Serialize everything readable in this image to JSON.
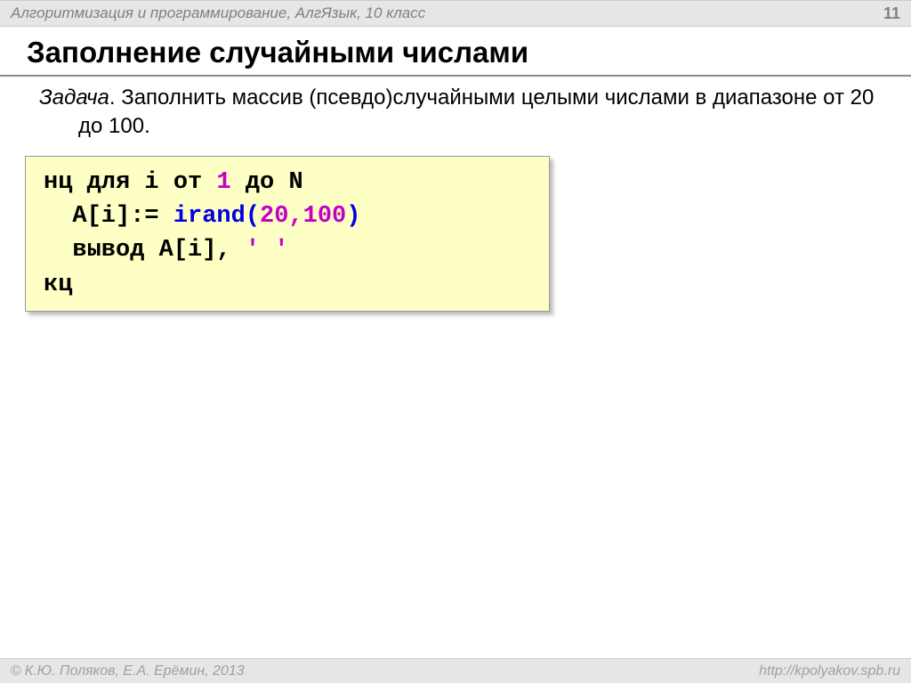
{
  "header": {
    "breadcrumb": "Алгоритмизация и программирование, АлгЯзык, 10 класс",
    "page_number": "11"
  },
  "title": "Заполнение случайными числами",
  "task": {
    "label": "Задача",
    "text": ". Заполнить массив (псевдо)случайными целыми числами в диапазоне от 20 до 100."
  },
  "code": {
    "l1_a": "нц для i от ",
    "l1_num": "1",
    "l1_b": " до N",
    "l2_a": "  A[i]:= ",
    "l2_fn": "irand(",
    "l2_args": "20,100",
    "l2_close": ")",
    "l3_a": "  вывод A[i], ",
    "l3_q": "' '",
    "l4": "кц"
  },
  "footer": {
    "left": "К.Ю. Поляков, Е.А. Ерёмин, 2013",
    "right": "http://kpolyakov.spb.ru"
  }
}
